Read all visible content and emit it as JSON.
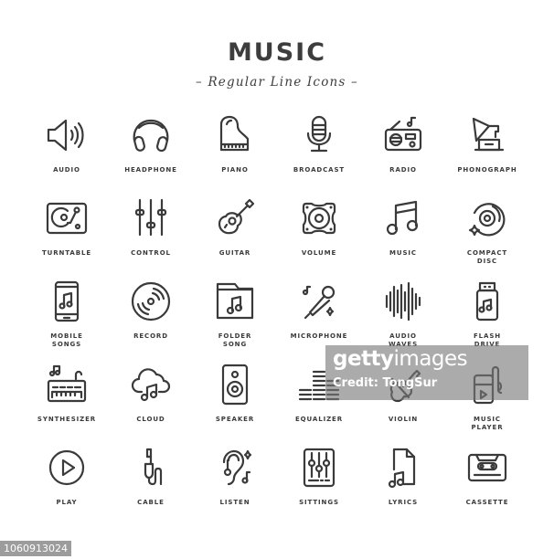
{
  "header": {
    "title": "MUSIC",
    "subtitle": "– Regular Line Icons –"
  },
  "icons": [
    {
      "label": "AUDIO",
      "icon": "speaker-volume-icon"
    },
    {
      "label": "HEADPHONE",
      "icon": "headphone-icon"
    },
    {
      "label": "PIANO",
      "icon": "piano-icon"
    },
    {
      "label": "BROADCAST",
      "icon": "microphone-stand-icon"
    },
    {
      "label": "RADIO",
      "icon": "radio-icon"
    },
    {
      "label": "PHONOGRAPH",
      "icon": "phonograph-icon"
    },
    {
      "label": "TURNTABLE",
      "icon": "turntable-icon"
    },
    {
      "label": "CONTROL",
      "icon": "sliders-icon"
    },
    {
      "label": "GUITAR",
      "icon": "guitar-icon"
    },
    {
      "label": "VOLUME",
      "icon": "loudspeaker-icon"
    },
    {
      "label": "MUSIC",
      "icon": "music-note-icon"
    },
    {
      "label": "COMPACT\nDISC",
      "icon": "compact-disc-icon"
    },
    {
      "label": "MOBILE\nSONGS",
      "icon": "mobile-music-icon"
    },
    {
      "label": "RECORD",
      "icon": "vinyl-record-icon"
    },
    {
      "label": "FOLDER\nSONG",
      "icon": "music-folder-icon"
    },
    {
      "label": "MICROPHONE",
      "icon": "handheld-microphone-icon"
    },
    {
      "label": "AUDIO\nWAVES",
      "icon": "sound-waves-icon"
    },
    {
      "label": "FLASH\nDRIVE",
      "icon": "usb-music-icon"
    },
    {
      "label": "SYNTHESIZER",
      "icon": "synthesizer-icon"
    },
    {
      "label": "CLOUD",
      "icon": "music-cloud-icon"
    },
    {
      "label": "SPEAKER",
      "icon": "speaker-box-icon"
    },
    {
      "label": "EQUALIZER",
      "icon": "equalizer-icon"
    },
    {
      "label": "VIOLIN",
      "icon": "violin-icon"
    },
    {
      "label": "MUSIC\nPLAYER",
      "icon": "music-player-icon"
    },
    {
      "label": "PLAY",
      "icon": "play-circle-icon"
    },
    {
      "label": "CABLE",
      "icon": "audio-jack-icon"
    },
    {
      "label": "LISTEN",
      "icon": "ear-music-icon"
    },
    {
      "label": "SITTINGS",
      "icon": "mixer-settings-icon"
    },
    {
      "label": "LYRICS",
      "icon": "lyrics-file-icon"
    },
    {
      "label": "CASSETTE",
      "icon": "cassette-icon"
    }
  ],
  "watermark": {
    "brand_bold": "getty",
    "brand_light": "images",
    "credit": "Credit: TongSur"
  },
  "image_id": "1060913024"
}
